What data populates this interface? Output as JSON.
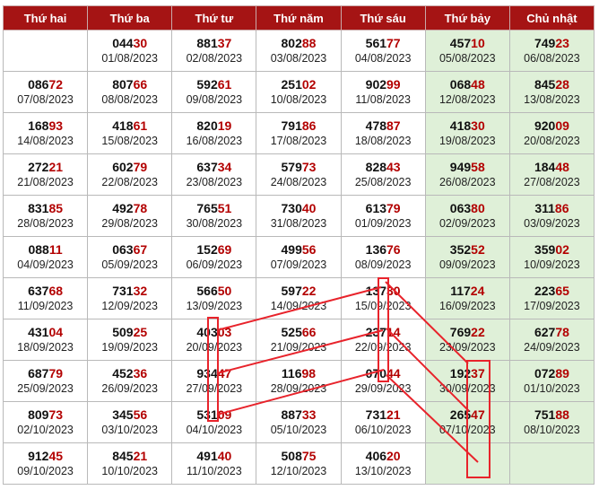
{
  "headers": [
    "Thứ hai",
    "Thứ ba",
    "Thứ tư",
    "Thứ năm",
    "Thứ sáu",
    "Thứ bảy",
    "Chủ nhật"
  ],
  "weekend_color": "#dff0d8",
  "header_color": "#a51414",
  "tail_color": "#b30000",
  "rows": [
    [
      null,
      {
        "lead": "044",
        "tail": "30",
        "date": "01/08/2023"
      },
      {
        "lead": "881",
        "tail": "37",
        "date": "02/08/2023"
      },
      {
        "lead": "802",
        "tail": "88",
        "date": "03/08/2023"
      },
      {
        "lead": "561",
        "tail": "77",
        "date": "04/08/2023"
      },
      {
        "lead": "457",
        "tail": "10",
        "date": "05/08/2023"
      },
      {
        "lead": "749",
        "tail": "23",
        "date": "06/08/2023"
      }
    ],
    [
      {
        "lead": "086",
        "tail": "72",
        "date": "07/08/2023"
      },
      {
        "lead": "807",
        "tail": "66",
        "date": "08/08/2023"
      },
      {
        "lead": "592",
        "tail": "61",
        "date": "09/08/2023"
      },
      {
        "lead": "251",
        "tail": "02",
        "date": "10/08/2023"
      },
      {
        "lead": "902",
        "tail": "99",
        "date": "11/08/2023"
      },
      {
        "lead": "068",
        "tail": "48",
        "date": "12/08/2023"
      },
      {
        "lead": "845",
        "tail": "28",
        "date": "13/08/2023"
      }
    ],
    [
      {
        "lead": "168",
        "tail": "93",
        "date": "14/08/2023"
      },
      {
        "lead": "418",
        "tail": "61",
        "date": "15/08/2023"
      },
      {
        "lead": "820",
        "tail": "19",
        "date": "16/08/2023"
      },
      {
        "lead": "791",
        "tail": "86",
        "date": "17/08/2023"
      },
      {
        "lead": "478",
        "tail": "87",
        "date": "18/08/2023"
      },
      {
        "lead": "418",
        "tail": "30",
        "date": "19/08/2023"
      },
      {
        "lead": "920",
        "tail": "09",
        "date": "20/08/2023"
      }
    ],
    [
      {
        "lead": "272",
        "tail": "21",
        "date": "21/08/2023"
      },
      {
        "lead": "602",
        "tail": "79",
        "date": "22/08/2023"
      },
      {
        "lead": "637",
        "tail": "34",
        "date": "23/08/2023"
      },
      {
        "lead": "579",
        "tail": "73",
        "date": "24/08/2023"
      },
      {
        "lead": "828",
        "tail": "43",
        "date": "25/08/2023"
      },
      {
        "lead": "949",
        "tail": "58",
        "date": "26/08/2023"
      },
      {
        "lead": "184",
        "tail": "48",
        "date": "27/08/2023"
      }
    ],
    [
      {
        "lead": "831",
        "tail": "85",
        "date": "28/08/2023"
      },
      {
        "lead": "492",
        "tail": "78",
        "date": "29/08/2023"
      },
      {
        "lead": "765",
        "tail": "51",
        "date": "30/08/2023"
      },
      {
        "lead": "730",
        "tail": "40",
        "date": "31/08/2023"
      },
      {
        "lead": "613",
        "tail": "79",
        "date": "01/09/2023"
      },
      {
        "lead": "063",
        "tail": "80",
        "date": "02/09/2023"
      },
      {
        "lead": "311",
        "tail": "86",
        "date": "03/09/2023"
      }
    ],
    [
      {
        "lead": "088",
        "tail": "11",
        "date": "04/09/2023"
      },
      {
        "lead": "063",
        "tail": "67",
        "date": "05/09/2023"
      },
      {
        "lead": "152",
        "tail": "69",
        "date": "06/09/2023"
      },
      {
        "lead": "499",
        "tail": "56",
        "date": "07/09/2023"
      },
      {
        "lead": "136",
        "tail": "76",
        "date": "08/09/2023"
      },
      {
        "lead": "352",
        "tail": "52",
        "date": "09/09/2023"
      },
      {
        "lead": "359",
        "tail": "02",
        "date": "10/09/2023"
      }
    ],
    [
      {
        "lead": "637",
        "tail": "68",
        "date": "11/09/2023"
      },
      {
        "lead": "731",
        "tail": "32",
        "date": "12/09/2023"
      },
      {
        "lead": "566",
        "tail": "50",
        "date": "13/09/2023"
      },
      {
        "lead": "597",
        "tail": "22",
        "date": "14/09/2023"
      },
      {
        "lead": "137",
        "tail": "30",
        "date": "15/09/2023"
      },
      {
        "lead": "117",
        "tail": "24",
        "date": "16/09/2023"
      },
      {
        "lead": "223",
        "tail": "65",
        "date": "17/09/2023"
      }
    ],
    [
      {
        "lead": "431",
        "tail": "04",
        "date": "18/09/2023"
      },
      {
        "lead": "509",
        "tail": "25",
        "date": "19/09/2023"
      },
      {
        "lead": "403",
        "tail": "03",
        "date": "20/09/2023"
      },
      {
        "lead": "525",
        "tail": "66",
        "date": "21/09/2023"
      },
      {
        "lead": "237",
        "tail": "14",
        "date": "22/09/2023"
      },
      {
        "lead": "769",
        "tail": "22",
        "date": "23/09/2023"
      },
      {
        "lead": "627",
        "tail": "78",
        "date": "24/09/2023"
      }
    ],
    [
      {
        "lead": "687",
        "tail": "79",
        "date": "25/09/2023"
      },
      {
        "lead": "452",
        "tail": "36",
        "date": "26/09/2023"
      },
      {
        "lead": "934",
        "tail": "47",
        "date": "27/09/2023"
      },
      {
        "lead": "116",
        "tail": "98",
        "date": "28/09/2023"
      },
      {
        "lead": "070",
        "tail": "44",
        "date": "29/09/2023"
      },
      {
        "lead": "192",
        "tail": "37",
        "date": "30/09/2023"
      },
      {
        "lead": "072",
        "tail": "89",
        "date": "01/10/2023"
      }
    ],
    [
      {
        "lead": "809",
        "tail": "73",
        "date": "02/10/2023"
      },
      {
        "lead": "345",
        "tail": "56",
        "date": "03/10/2023"
      },
      {
        "lead": "531",
        "tail": "09",
        "date": "04/10/2023"
      },
      {
        "lead": "887",
        "tail": "33",
        "date": "05/10/2023"
      },
      {
        "lead": "731",
        "tail": "21",
        "date": "06/10/2023"
      },
      {
        "lead": "265",
        "tail": "47",
        "date": "07/10/2023"
      },
      {
        "lead": "751",
        "tail": "88",
        "date": "08/10/2023"
      }
    ],
    [
      {
        "lead": "912",
        "tail": "45",
        "date": "09/10/2023"
      },
      {
        "lead": "845",
        "tail": "21",
        "date": "10/10/2023"
      },
      {
        "lead": "491",
        "tail": "40",
        "date": "11/10/2023"
      },
      {
        "lead": "508",
        "tail": "75",
        "date": "12/10/2023"
      },
      {
        "lead": "406",
        "tail": "20",
        "date": "13/10/2023"
      },
      null,
      null
    ]
  ]
}
